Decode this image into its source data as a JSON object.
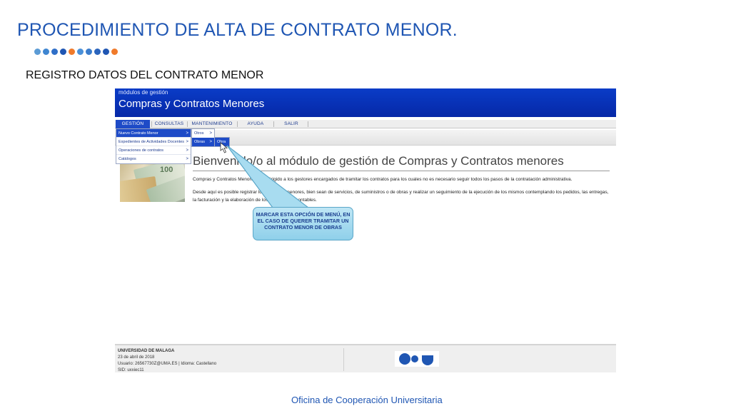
{
  "slide": {
    "title": "PROCEDIMIENTO DE ALTA DE CONTRATO MENOR.",
    "subtitle": "REGISTRO DATOS DEL CONTRATO MENOR",
    "footer": "Oficina de Cooperación Universitaria",
    "dot_colors": [
      "#5b9bd5",
      "#3f86d1",
      "#2f6fc8",
      "#1f56b3",
      "#f07a2a",
      "#4a90d9",
      "#3a7ccc",
      "#2a64bd",
      "#1f56b3",
      "#f07a2a"
    ]
  },
  "app": {
    "module_label": "módulos de gestión",
    "title": "Compras y Contratos Menores",
    "menu": {
      "gestion": "GESTIÓN",
      "consultas": "CONSULTAS",
      "mantenimiento": "MANTENIMIENTO",
      "ayuda": "AYUDA",
      "salir": "SALIR"
    },
    "dropdown": [
      {
        "label": "Nuevo Contrato Menor",
        "arrow": ">"
      },
      {
        "label": "Expedientes de Actividades Docentes",
        "arrow": ">"
      },
      {
        "label": "Operaciones de contratos",
        "arrow": ">"
      },
      {
        "label": "Catálogos",
        "arrow": ">"
      }
    ],
    "submenu1": [
      {
        "label": "Otros",
        "arrow": ">"
      },
      {
        "label": "Obras",
        "arrow": ">"
      }
    ],
    "submenu2": [
      {
        "label": "Obra"
      }
    ],
    "welcome": "Bienvenido/o al módulo de gestión de Compras y Contratos menores",
    "para1": "Compras y Contratos Menores está dirigido a los gestores encargados de tramitar los contratos para los cuales no es necesario seguir todos los pasos de la contratación administrativa.",
    "para2": "Desde aquí es posible registrar los contratos menores, bien sean de servicios, de suministros o de obras y realizar un seguimiento de la ejecución de los mismos contemplando los pedidos, las entregas, la facturación y la elaboración de los documentos contables.",
    "bill_label": "100",
    "footer": {
      "university": "UNIVERSIDAD DE MALAGA",
      "date": "23 de abril de 2018",
      "user": "Usuario: 26567730Z@UMA.ES | Idioma: Castellano",
      "sid": "SID: uxxiec11"
    }
  },
  "callout": {
    "text": "MARCAR ESTA OPCIÓN DE MENÚ, EN EL CASO DE QUERER TRAMITAR UN CONTRATO MENOR DE OBRAS"
  }
}
